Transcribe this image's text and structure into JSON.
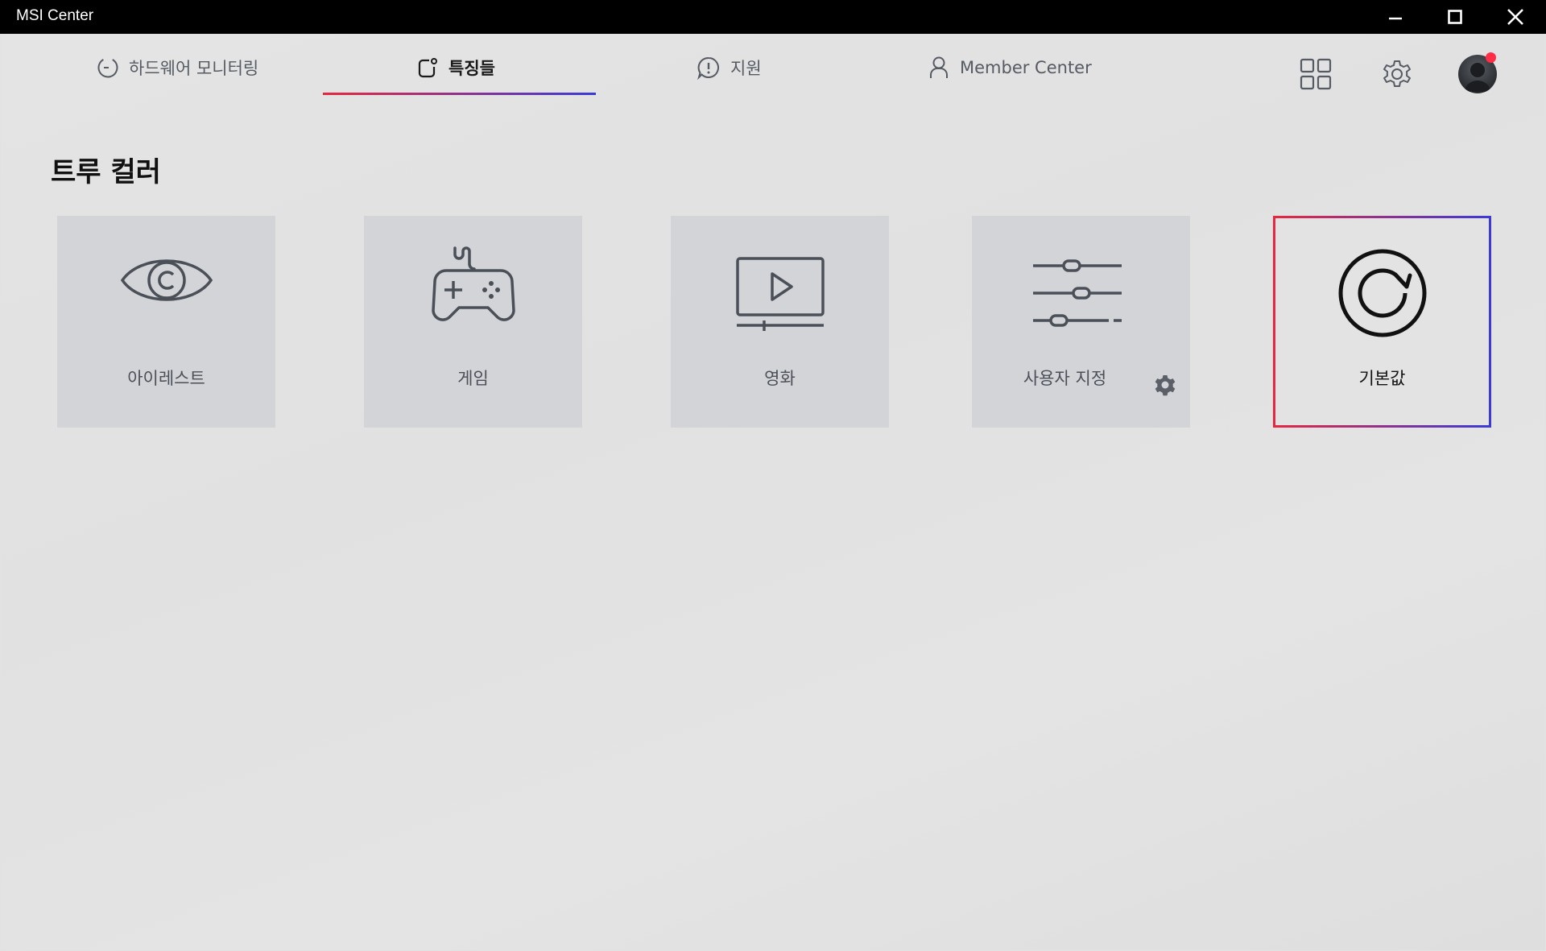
{
  "window": {
    "title": "MSI Center",
    "controls": [
      "minimize-icon",
      "maximize-icon",
      "close-icon"
    ]
  },
  "nav": {
    "tabs": [
      {
        "label": "하드웨어 모니터링",
        "icon": "monitor-gauge-icon",
        "active": false
      },
      {
        "label": "특징들",
        "icon": "features-icon",
        "active": true
      },
      {
        "label": "지원",
        "icon": "support-icon",
        "active": false
      },
      {
        "label": "Member Center",
        "icon": "person-icon",
        "active": false
      }
    ],
    "right_icons": [
      "grid-icon",
      "gear-icon",
      "avatar"
    ],
    "notification": true
  },
  "page": {
    "title": "트루 컬러"
  },
  "modes": [
    {
      "label": "아이레스트",
      "icon": "eye-icon",
      "selected": false
    },
    {
      "label": "게임",
      "icon": "gamepad-icon",
      "selected": false
    },
    {
      "label": "영화",
      "icon": "movie-icon",
      "selected": false
    },
    {
      "label": "사용자 지정",
      "icon": "sliders-icon",
      "selected": false,
      "has_settings": true
    },
    {
      "label": "기본값",
      "icon": "reset-icon",
      "selected": true
    }
  ],
  "colors": {
    "accent_start": "#e8273f",
    "accent_end": "#3a3ad8",
    "notification": "#ff2d45"
  }
}
